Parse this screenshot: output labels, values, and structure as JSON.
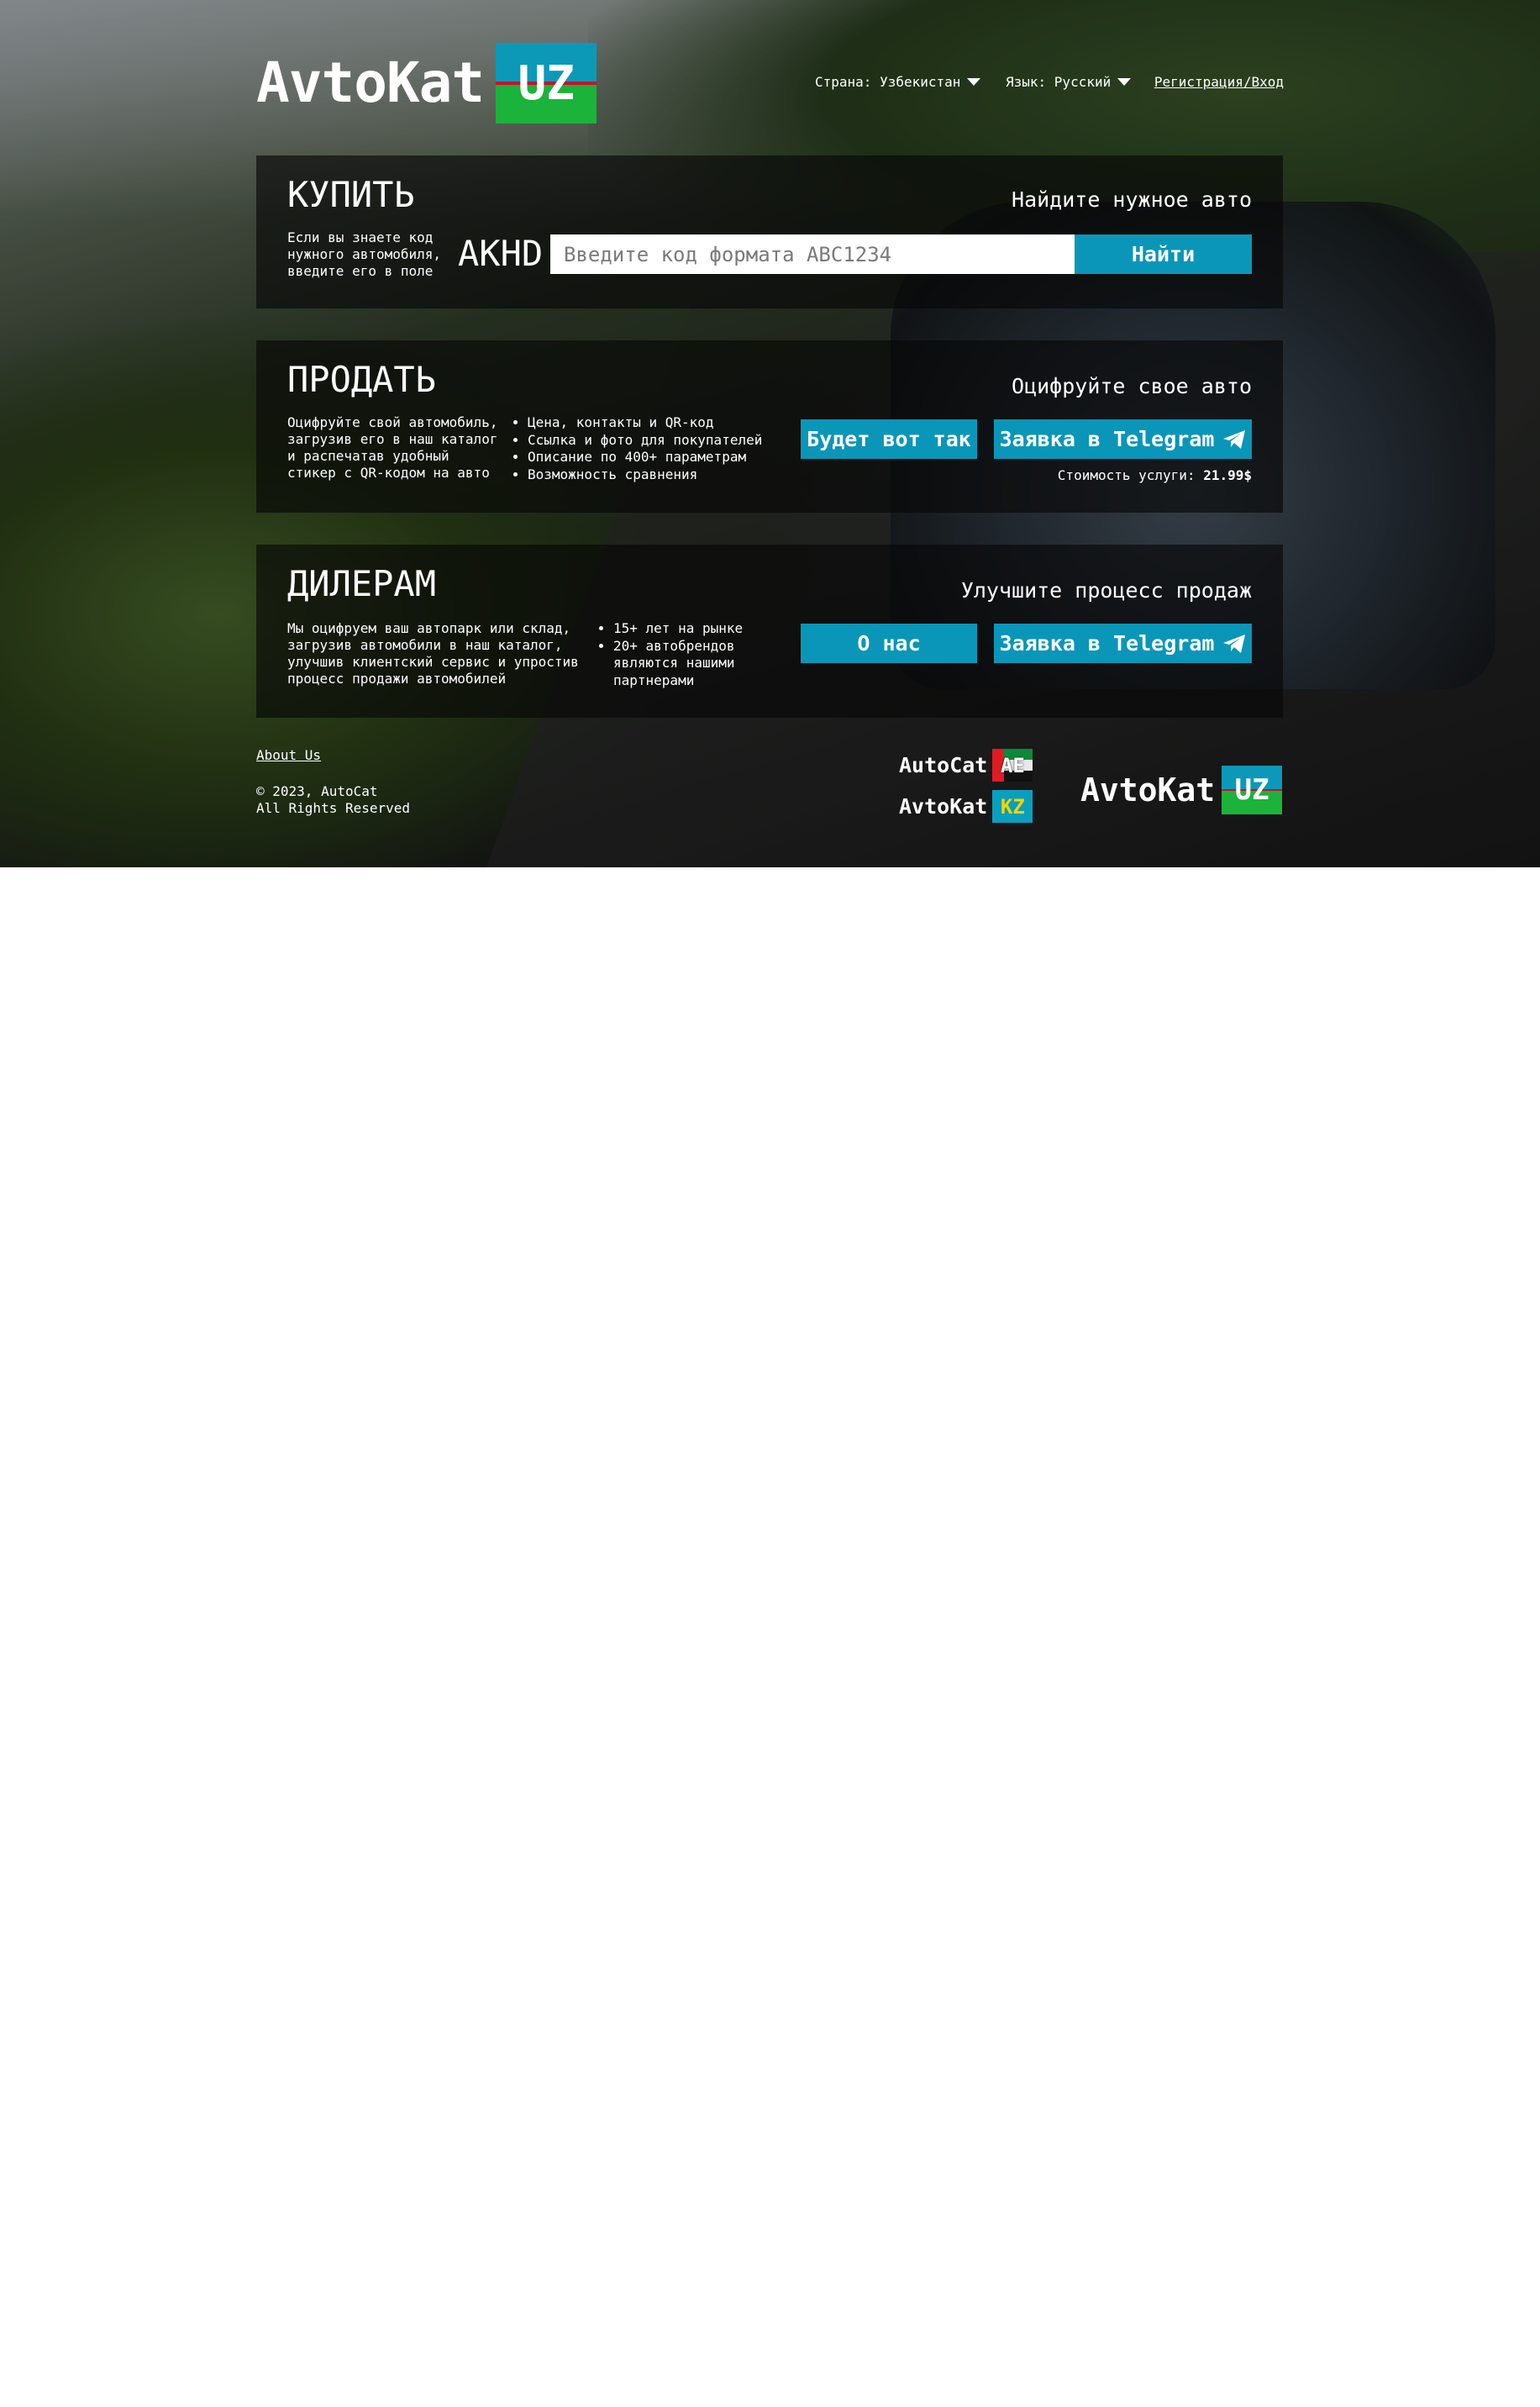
{
  "header": {
    "brand": "AvtoKat",
    "brand_flag": "UZ",
    "country_label": "Страна: Узбекистан",
    "language_label": "Язык: Русский",
    "auth_link": "Регистрация/Вход"
  },
  "buy": {
    "title": "КУПИТЬ",
    "tagline": "Найдите нужное авто",
    "description": "Если вы знаете код нужного автомобиля, введите его в поле",
    "code_prefix": "AKHD",
    "search_placeholder": "Введите код формата ABC1234",
    "search_button": "Найти"
  },
  "sell": {
    "title": "ПРОДАТЬ",
    "tagline": "Оцифруйте свое авто",
    "description": "Оцифруйте свой автомобиль, загрузив его в наш каталог и распечатав удобный стикер с QR-кодом на авто",
    "features": [
      "Цена, контакты и QR-код",
      "Ссылка и фото для покупателей",
      "Описание по 400+ параметрам",
      "Возможность сравнения"
    ],
    "preview_button": "Будет вот так",
    "telegram_button": "Заявка в Telegram",
    "price_label": "Стоимость услуги:",
    "price_value": "21.99$"
  },
  "dealers": {
    "title": "ДИЛЕРАМ",
    "tagline": "Улучшите процесс продаж",
    "description": "Мы оцифруем ваш автопарк или склад, загрузив автомобили в наш каталог, улучшив клиентский сервис и упростив процесс продажи автомобилей",
    "features": [
      "15+ лет на рынке",
      "20+ автобрендов являются нашими партнерами"
    ],
    "about_button": "О нас",
    "telegram_button": "Заявка в Telegram"
  },
  "footer": {
    "about_link": "About Us",
    "copyright_line1": "© 2023, AutoCat",
    "copyright_line2": "All Rights Reserved",
    "regional_sites": [
      {
        "name": "AutoCat",
        "code": "AE"
      },
      {
        "name": "AvtoKat",
        "code": "KZ"
      }
    ],
    "brand": "AvtoKat",
    "brand_flag": "UZ"
  },
  "colors": {
    "accent": "#0a96b8",
    "uz_blue": "#0c99b8",
    "uz_green": "#1bb33a",
    "uz_red": "#c8102e",
    "kz_yellow": "#f4d400"
  }
}
